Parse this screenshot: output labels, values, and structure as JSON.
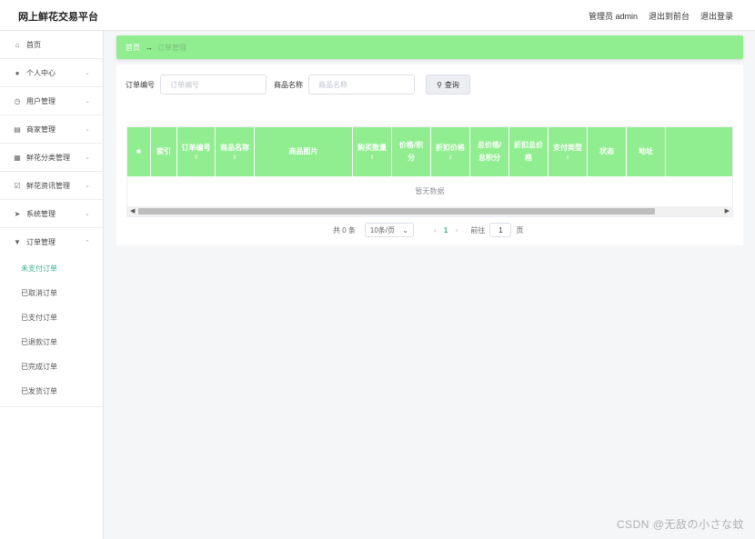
{
  "app_title": "网上鲜花交易平台",
  "header": {
    "admin_label": "管理员 admin",
    "to_frontend": "退出到前台",
    "logout": "退出登录"
  },
  "sidebar": {
    "items": [
      {
        "label": "首页",
        "icon": "home-icon"
      },
      {
        "label": "个人中心",
        "icon": "user-icon"
      },
      {
        "label": "用户管理",
        "icon": "clock-icon"
      },
      {
        "label": "商家管理",
        "icon": "shop-icon"
      },
      {
        "label": "鲜花分类管理",
        "icon": "grid-icon"
      },
      {
        "label": "鲜花资讯管理",
        "icon": "news-icon"
      },
      {
        "label": "系统管理",
        "icon": "send-icon"
      },
      {
        "label": "订单管理",
        "icon": "order-icon"
      }
    ],
    "submenu": [
      {
        "label": "未支付订单"
      },
      {
        "label": "已取消订单"
      },
      {
        "label": "已支付订单"
      },
      {
        "label": "已退款订单"
      },
      {
        "label": "已完成订单"
      },
      {
        "label": "已发货订单"
      }
    ]
  },
  "breadcrumb": {
    "home": "首页",
    "arrow": "→",
    "current": "订单管理"
  },
  "search": {
    "order_no_label": "订单编号",
    "order_no_placeholder": "订单编号",
    "product_name_label": "商品名称",
    "product_name_placeholder": "商品名称",
    "query_button": "查询"
  },
  "table": {
    "columns": [
      {
        "label": ""
      },
      {
        "label": "索引"
      },
      {
        "label": "订单编号"
      },
      {
        "label": "商品名称"
      },
      {
        "label": "商品图片"
      },
      {
        "label": "购买数量"
      },
      {
        "label": "价格/积分"
      },
      {
        "label": "折扣价格"
      },
      {
        "label": "总价格/总积分"
      },
      {
        "label": "折扣总价格"
      },
      {
        "label": "支付类型"
      },
      {
        "label": "状态"
      },
      {
        "label": "地址"
      },
      {
        "label": ""
      }
    ],
    "empty_text": "暂无数据"
  },
  "pagination": {
    "total": "共 0 条",
    "page_size": "10条/页",
    "current_page": "1",
    "goto_label": "前往",
    "goto_value": "1",
    "page_suffix": "页"
  },
  "watermark": "CSDN @无敌の小さな蚊",
  "colors": {
    "accent_green": "#90ee90",
    "active_menu": "#3bb08f"
  }
}
